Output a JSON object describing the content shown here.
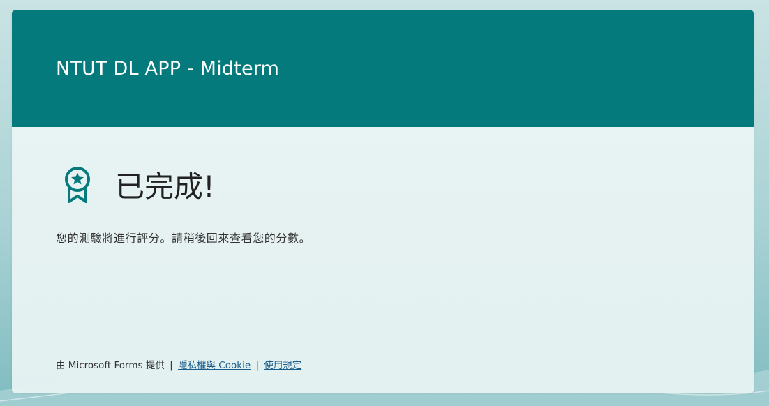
{
  "form": {
    "title": "NTUT DL APP - Midterm"
  },
  "completion": {
    "heading": "已完成!",
    "icon": "award-ribbon-icon",
    "message": "您的測驗將進行評分。請稍後回來查看您的分數。"
  },
  "footer": {
    "powered_by": "由 Microsoft Forms 提供",
    "separator": "|",
    "privacy_link": "隱私權與 Cookie",
    "terms_link": "使用規定"
  },
  "colors": {
    "header_bg": "#047a7d",
    "accent": "#047a7d",
    "link": "#1b5e8c"
  }
}
